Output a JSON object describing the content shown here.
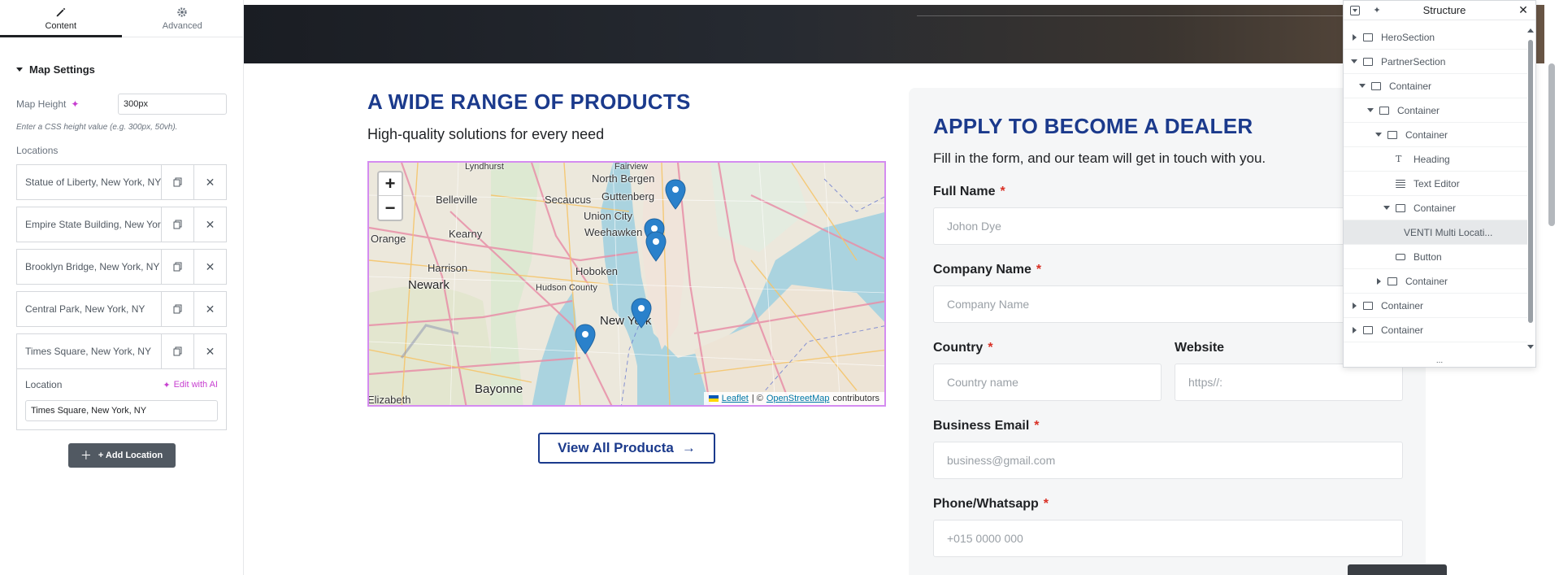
{
  "left_panel": {
    "tabs": [
      {
        "label": "Content",
        "icon": "pencil-icon",
        "active": true
      },
      {
        "label": "Advanced",
        "icon": "gear-icon",
        "active": false
      }
    ],
    "section_title": "Map Settings",
    "map_height": {
      "label": "Map Height",
      "value": "300px",
      "help": "Enter a CSS height value (e.g. 300px, 50vh)."
    },
    "locations_label": "Locations",
    "locations": [
      "Statue of Liberty, New York, NY",
      "Empire State Building, New York, NY",
      "Brooklyn Bridge, New York, NY",
      "Central Park, New York, NY",
      "Times Square, New York, NY"
    ],
    "expanded": {
      "label": "Location",
      "edit_ai": "Edit with AI",
      "value": "Times Square, New York, NY"
    },
    "add_location": "+ Add Location"
  },
  "canvas": {
    "products": {
      "heading": "A WIDE RANGE OF PRODUCTS",
      "subheading": "High-quality solutions for every need",
      "view_all": "View All Producta"
    },
    "map": {
      "labels": [
        "Lyndhurst",
        "Fairview",
        "North Bergen",
        "Belleville",
        "Secaucus",
        "Guttenberg",
        "Union City",
        "Weehawken",
        "Kearny",
        "Orange",
        "Harrison",
        "Hoboken",
        "Newark",
        "Hudson County",
        "New York",
        "Bayonne",
        "Elizabeth"
      ],
      "zoom_in": "+",
      "zoom_out": "−",
      "attribution": {
        "leaflet": "Leaflet",
        "sep": "| ©",
        "osm": "OpenStreetMap",
        "suffix": "contributors"
      }
    },
    "dealer": {
      "heading": "APPLY TO BECOME A DEALER",
      "subheading": "Fill in the form, and our team will get in touch with you.",
      "fields": {
        "full_name": {
          "label": "Full Name",
          "placeholder": "Johon Dye"
        },
        "company": {
          "label": "Company Name",
          "placeholder": "Company Name"
        },
        "country": {
          "label": "Country",
          "placeholder": "Country name"
        },
        "website": {
          "label": "Website",
          "placeholder": "https//:"
        },
        "email": {
          "label": "Business Email",
          "placeholder": "business@gmail.com"
        },
        "phone": {
          "label": "Phone/Whatsapp",
          "placeholder": "+015 0000 000"
        }
      },
      "required_mark": "*"
    }
  },
  "structure": {
    "title": "Structure",
    "items": [
      {
        "label": "HeroSection",
        "depth": 0,
        "expander": "right",
        "icon": "container"
      },
      {
        "label": "PartnerSection",
        "depth": 0,
        "expander": "down",
        "icon": "container"
      },
      {
        "label": "Container",
        "depth": 1,
        "expander": "down",
        "icon": "container"
      },
      {
        "label": "Container",
        "depth": 2,
        "expander": "down",
        "icon": "container"
      },
      {
        "label": "Container",
        "depth": 3,
        "expander": "down",
        "icon": "container"
      },
      {
        "label": "Heading",
        "depth": 4,
        "expander": "none",
        "icon": "heading"
      },
      {
        "label": "Text Editor",
        "depth": 4,
        "expander": "none",
        "icon": "text"
      },
      {
        "label": "Container",
        "depth": 4,
        "expander": "down",
        "icon": "container"
      },
      {
        "label": "VENTI Multi Locati...",
        "depth": 5,
        "expander": "none",
        "icon": "map",
        "selected": true
      },
      {
        "label": "Button",
        "depth": 4,
        "expander": "none",
        "icon": "button"
      },
      {
        "label": "Container",
        "depth": 3,
        "expander": "right",
        "icon": "container"
      },
      {
        "label": "Container",
        "depth": 0,
        "expander": "right",
        "icon": "container"
      },
      {
        "label": "Container",
        "depth": 0,
        "expander": "right",
        "icon": "container"
      }
    ],
    "more": "..."
  },
  "colors": {
    "accent_blue": "#1b3a8c",
    "ai_pink": "#c73fd0",
    "required_red": "#d93025"
  }
}
